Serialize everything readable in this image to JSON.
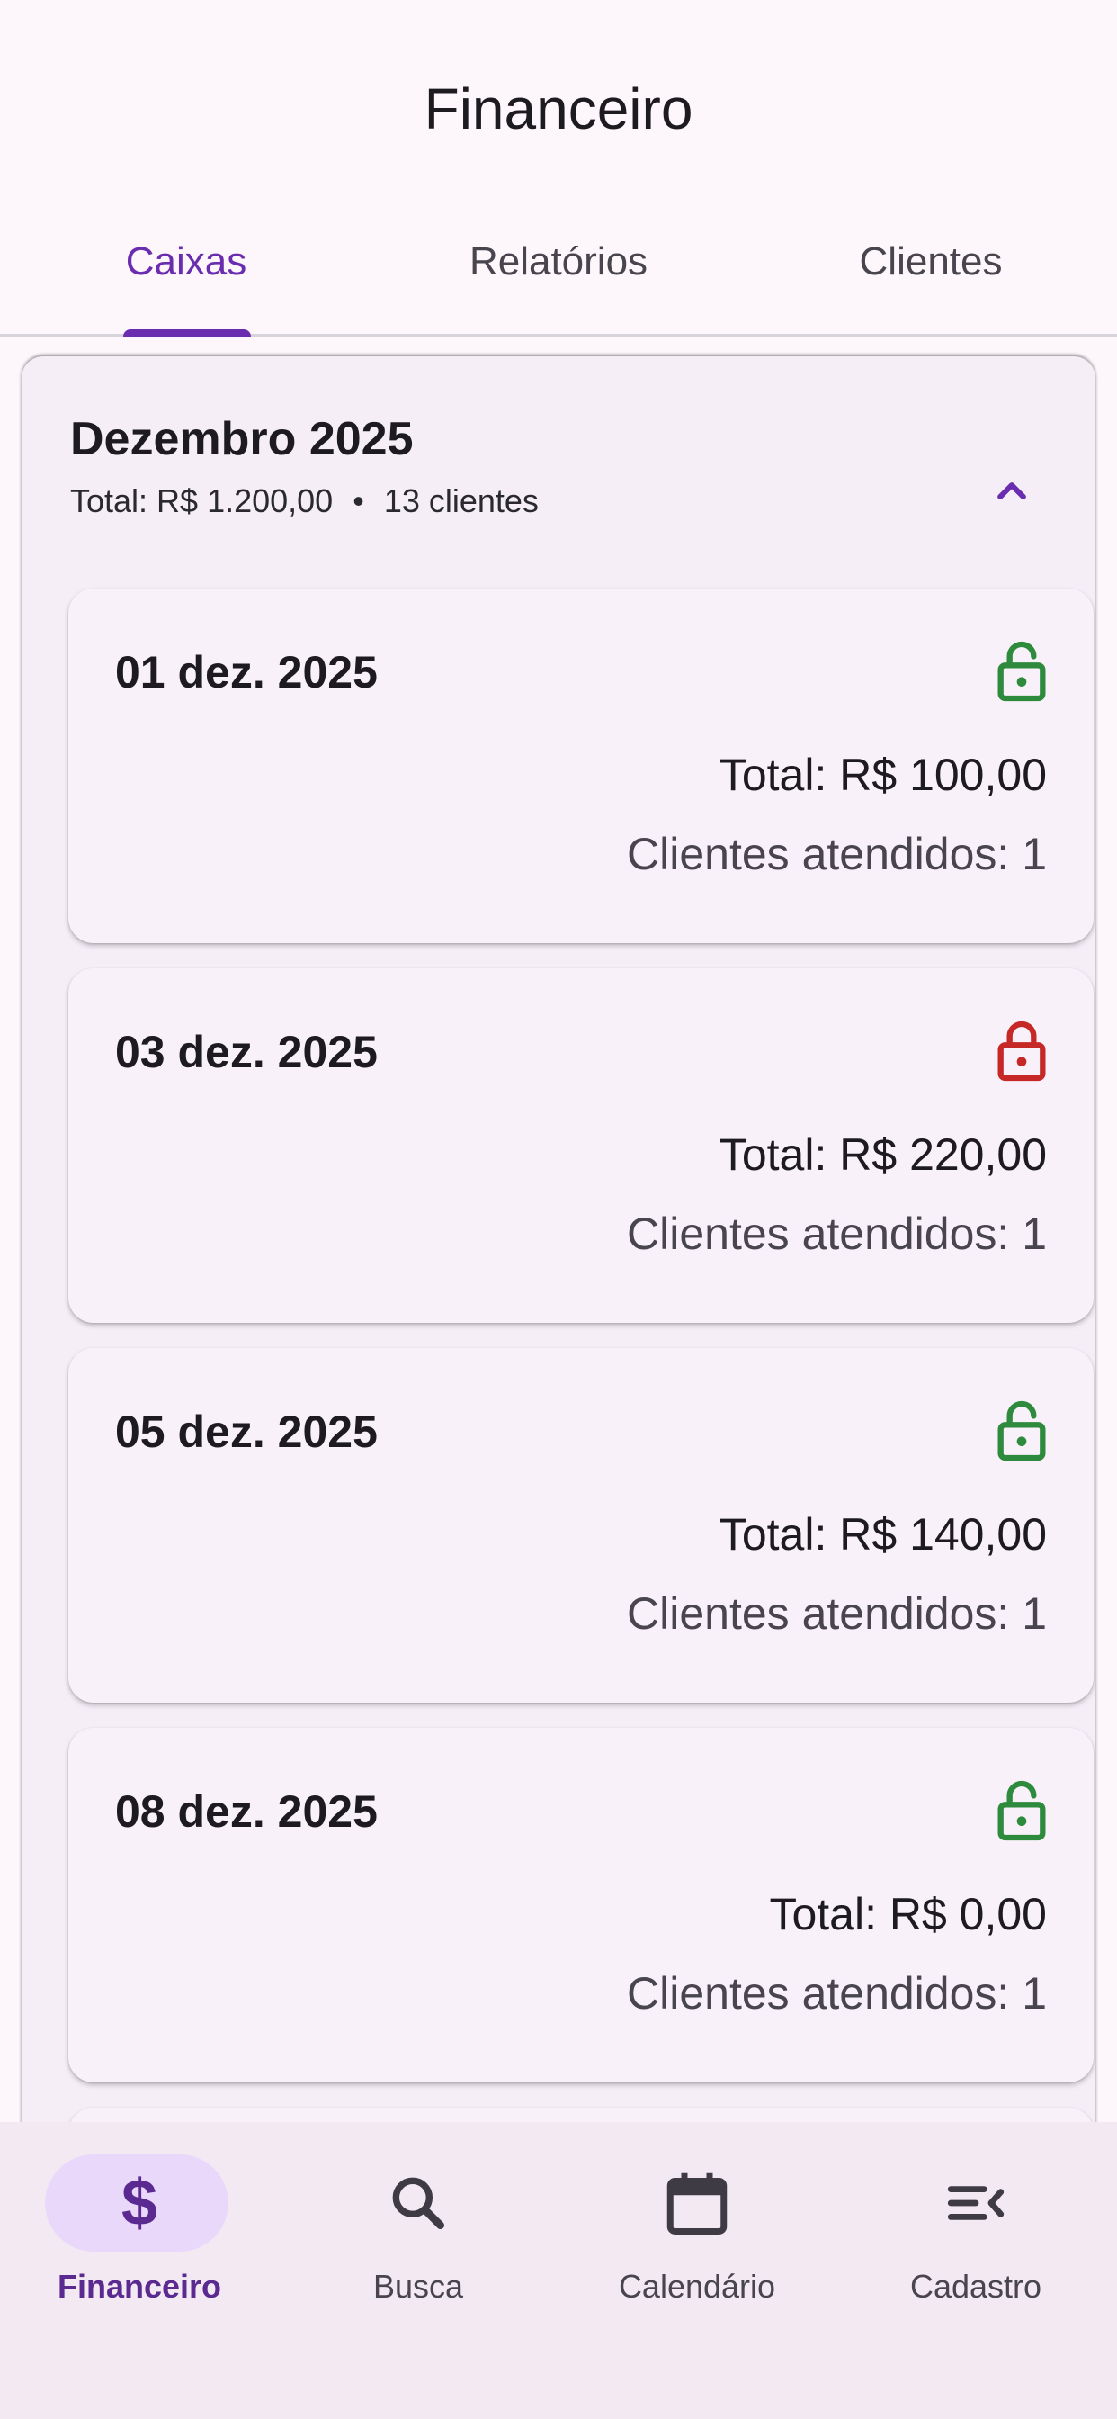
{
  "app_bar": {
    "title": "Financeiro"
  },
  "tabs": [
    {
      "label": "Caixas",
      "active": true
    },
    {
      "label": "Relatórios",
      "active": false
    },
    {
      "label": "Clientes",
      "active": false
    }
  ],
  "month": {
    "title": "Dezembro 2025",
    "total": "Total: R$ 1.200,00",
    "separator": "•",
    "clients": "13 clientes",
    "expanded_icon": "chevron-up-icon"
  },
  "cards": [
    {
      "date": "01 dez. 2025",
      "total": "Total: R$ 100,00",
      "clients": "Clientes atendidos: 1",
      "lock": "open",
      "lock_icon": "lock-open-icon",
      "lock_color": "#2e8b3d"
    },
    {
      "date": "03 dez. 2025",
      "total": "Total: R$ 220,00",
      "clients": "Clientes atendidos: 1",
      "lock": "closed",
      "lock_icon": "lock-closed-icon",
      "lock_color": "#c62828"
    },
    {
      "date": "05 dez. 2025",
      "total": "Total: R$ 140,00",
      "clients": "Clientes atendidos: 1",
      "lock": "open",
      "lock_icon": "lock-open-icon",
      "lock_color": "#2e8b3d"
    },
    {
      "date": "08 dez. 2025",
      "total": "Total: R$ 0,00",
      "clients": "Clientes atendidos: 1",
      "lock": "open",
      "lock_icon": "lock-open-icon",
      "lock_color": "#2e8b3d"
    }
  ],
  "bottom_nav": [
    {
      "label": "Financeiro",
      "icon": "dollar-icon",
      "active": true
    },
    {
      "label": "Busca",
      "icon": "search-icon",
      "active": false
    },
    {
      "label": "Calendário",
      "icon": "calendar-icon",
      "active": false
    },
    {
      "label": "Cadastro",
      "icon": "menu-collapse-icon",
      "active": false
    }
  ],
  "colors": {
    "primary": "#6a2db0",
    "lock_open": "#2e8b3d",
    "lock_closed": "#c62828",
    "background": "#fdf7fc"
  }
}
